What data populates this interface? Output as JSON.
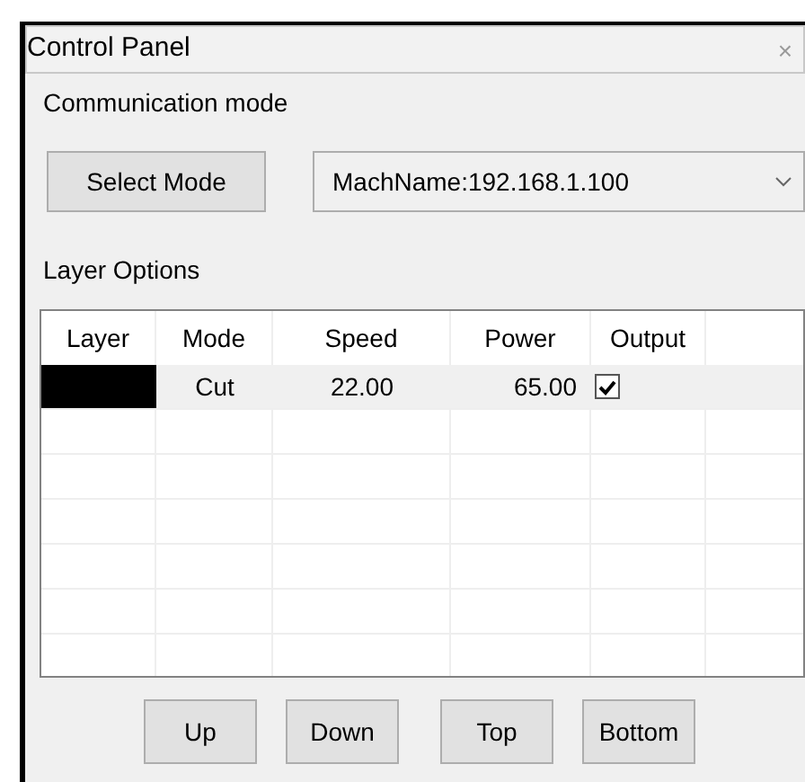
{
  "window": {
    "title": "Control Panel",
    "close": "×"
  },
  "communication": {
    "title": "Communication mode",
    "select_button": "Select Mode",
    "device": "MachName:192.168.1.100"
  },
  "layers": {
    "title": "Layer Options",
    "columns": [
      "Layer",
      "Mode",
      "Speed",
      "Power",
      "Output"
    ],
    "rows": [
      {
        "color": "#000000",
        "mode": "Cut",
        "speed": "22.00",
        "power": "65.00",
        "output": true
      }
    ]
  },
  "buttons": [
    "Up",
    "Down",
    "Top",
    "Bottom"
  ]
}
